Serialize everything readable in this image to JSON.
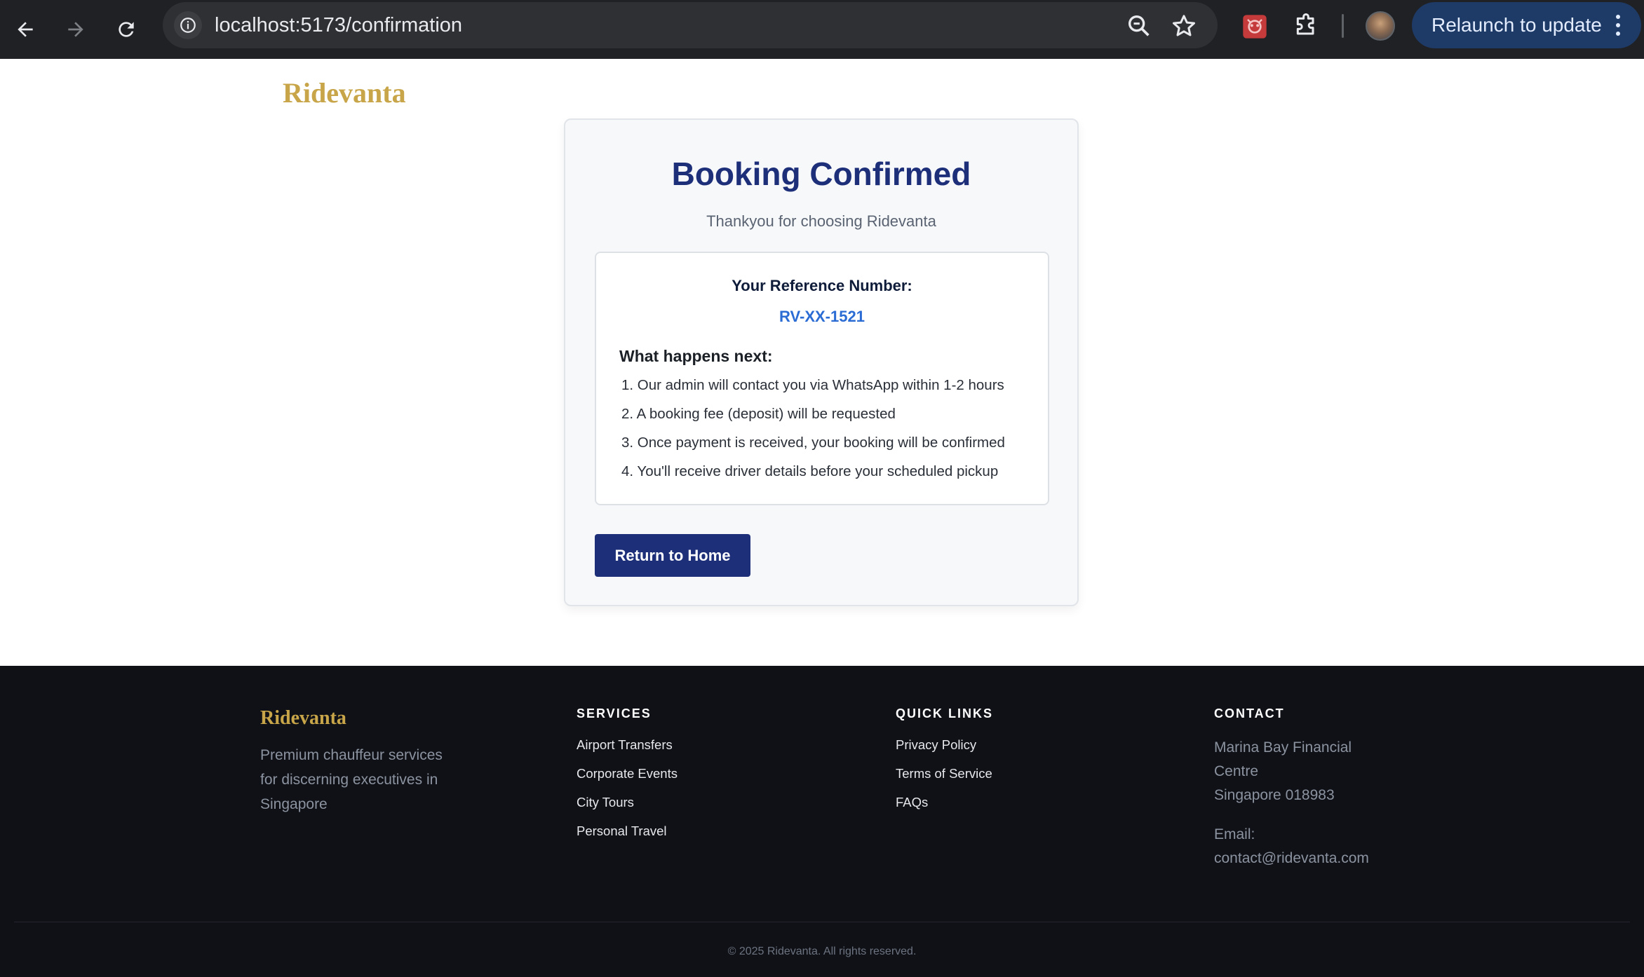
{
  "browser": {
    "url": "localhost:5173/confirmation",
    "relaunch_label": "Relaunch to update"
  },
  "page": {
    "brand": "Ridevanta",
    "card": {
      "title": "Booking Confirmed",
      "subtitle": "Thankyou for choosing Ridevanta",
      "reference_label": "Your Reference Number:",
      "reference_number": "RV-XX-1521",
      "next_title": "What happens next:",
      "steps": [
        "1. Our admin will contact you via WhatsApp within 1-2 hours",
        "2. A booking fee (deposit) will be requested",
        "3. Once payment is received, your booking will be confirmed",
        "4. You'll receive driver details before your scheduled pickup"
      ],
      "home_button": "Return to Home"
    }
  },
  "footer": {
    "brand": "Ridevanta",
    "description": "Premium chauffeur services for discerning executives in Singapore",
    "services_title": "SERVICES",
    "services": [
      "Airport Transfers",
      "Corporate Events",
      "City Tours",
      "Personal Travel"
    ],
    "quick_links_title": "QUICK LINKS",
    "quick_links": [
      "Privacy Policy",
      "Terms of Service",
      "FAQs"
    ],
    "contact_title": "CONTACT",
    "contact": {
      "address_line1": "Marina Bay Financial",
      "address_line2": "Centre",
      "address_line3": "Singapore 018983",
      "email_label": "Email:",
      "email": "contact@ridevanta.com"
    },
    "copyright": "© 2025 Ridevanta. All rights reserved."
  },
  "colors": {
    "brand_gold": "#c7a548",
    "primary_navy": "#1e2f7a",
    "reference_blue": "#2b6cd4",
    "footer_bg": "#0f1116"
  }
}
